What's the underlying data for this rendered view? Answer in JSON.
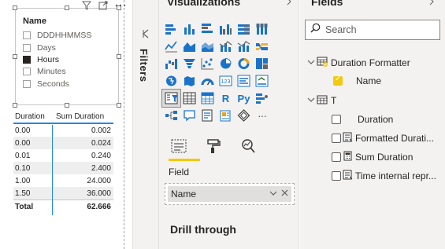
{
  "slicer": {
    "title": "Name",
    "items": [
      {
        "label": "DDDHHMMSS",
        "checked": false
      },
      {
        "label": "Days",
        "checked": false
      },
      {
        "label": "Hours",
        "checked": true
      },
      {
        "label": "Minutes",
        "checked": false
      },
      {
        "label": "Seconds",
        "checked": false
      }
    ],
    "header_icons": [
      "filter-icon",
      "focus-mode-icon",
      "more-options-icon"
    ]
  },
  "table": {
    "columns": [
      "Duration",
      "Sum Duration"
    ],
    "rows": [
      [
        "0.00",
        "0.002"
      ],
      [
        "0.00",
        "0.024"
      ],
      [
        "0.01",
        "0.240"
      ],
      [
        "0.10",
        "2.400"
      ],
      [
        "1.00",
        "24.000"
      ],
      [
        "1.50",
        "36.000"
      ]
    ],
    "total_label": "Total",
    "total_value": "62.666"
  },
  "filters_pane": {
    "label": "Filters",
    "expand_icon": "collapse-left-icon"
  },
  "visualizations": {
    "title": "Visualizations",
    "visual_r_label": "R",
    "visual_py_label": "Py",
    "more_label": "···",
    "field_label": "Field",
    "field_value": "Name",
    "drill_through": "Drill through",
    "tabs": [
      "fields-tab",
      "format-tab",
      "analytics-tab"
    ],
    "accent_color": "#f2c811"
  },
  "fields": {
    "title": "Fields",
    "search_placeholder": "Search",
    "tables": [
      {
        "name": "Duration Formatter",
        "fields": [
          {
            "name": "Name",
            "checked": true
          }
        ]
      },
      {
        "name": "T",
        "fields": [
          {
            "name": "Duration",
            "checked": false
          },
          {
            "name": "Formatted Durati...",
            "checked": false
          },
          {
            "name": "Sum Duration",
            "checked": false
          },
          {
            "name": "Time internal repr...",
            "checked": false
          }
        ]
      }
    ]
  }
}
